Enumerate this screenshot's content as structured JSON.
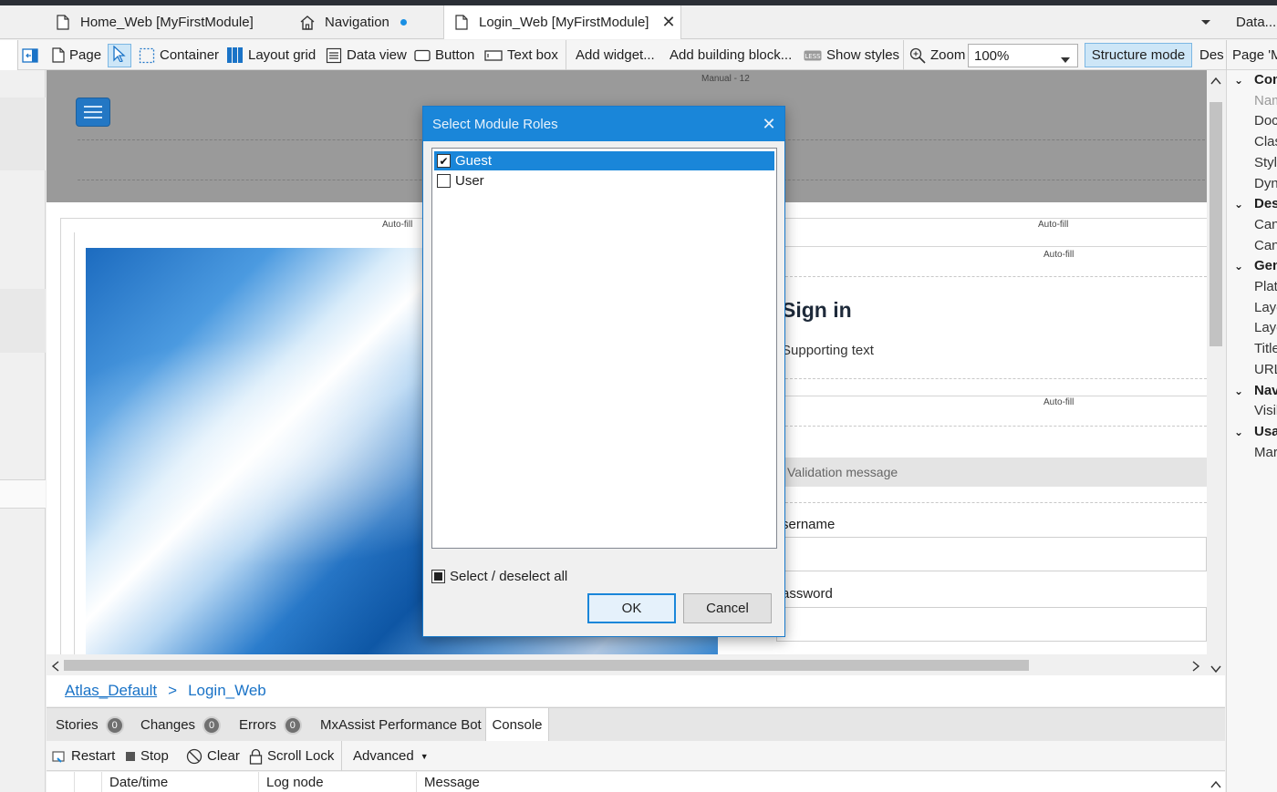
{
  "tabs": [
    {
      "label": "Home_Web [MyFirstModule]",
      "icon": "page-icon"
    },
    {
      "label": "Navigation",
      "icon": "home-icon",
      "modified": true
    },
    {
      "label": "Login_Web [MyFirstModule]",
      "icon": "page-icon",
      "active": true
    }
  ],
  "tabbar_right": "Data...",
  "toolbar": {
    "page": "Page",
    "container": "Container",
    "layout_grid": "Layout grid",
    "data_view": "Data view",
    "button": "Button",
    "text_box": "Text box",
    "add_widget": "Add widget...",
    "add_building_block": "Add building block...",
    "show_styles": "Show styles",
    "zoom": "Zoom",
    "zoom_value": "100%",
    "structure_mode": "Structure mode",
    "design": "Des",
    "page_props": "Page 'M"
  },
  "canvas": {
    "manual_label": "Manual - 12",
    "autofill": "Auto-fill",
    "sign_in": "Sign in",
    "supporting_text": "Supporting text",
    "validation_message": "Validation message",
    "username": "sername",
    "password": "assword"
  },
  "properties": [
    {
      "label": "Com",
      "category": true
    },
    {
      "label": "Nam",
      "category": false,
      "muted": true
    },
    {
      "label": "Doc",
      "category": false
    },
    {
      "label": "Clas",
      "category": false
    },
    {
      "label": "Styl",
      "category": false
    },
    {
      "label": "Dyn",
      "category": false
    },
    {
      "label": "Des",
      "category": true
    },
    {
      "label": "Can",
      "category": false
    },
    {
      "label": "Can",
      "category": false
    },
    {
      "label": "Gen",
      "category": true
    },
    {
      "label": "Plat",
      "category": false
    },
    {
      "label": "Layo",
      "category": false
    },
    {
      "label": "Layo",
      "category": false
    },
    {
      "label": "Title",
      "category": false
    },
    {
      "label": "URL",
      "category": false
    },
    {
      "label": "Nav",
      "category": true
    },
    {
      "label": "Visil",
      "category": false
    },
    {
      "label": "Usa",
      "category": true
    },
    {
      "label": "Mar",
      "category": false
    }
  ],
  "breadcrumb": {
    "parent": "Atlas_Default",
    "separator": ">",
    "current": "Login_Web"
  },
  "bottom_tabs": [
    {
      "label": "Stories",
      "badge": "0"
    },
    {
      "label": "Changes",
      "badge": "0"
    },
    {
      "label": "Errors",
      "badge": "0"
    },
    {
      "label": "MxAssist Performance Bot"
    },
    {
      "label": "Console",
      "active": true
    }
  ],
  "console_toolbar": {
    "restart": "Restart",
    "stop": "Stop",
    "clear": "Clear",
    "scroll_lock": "Scroll Lock",
    "advanced": "Advanced"
  },
  "log_columns": [
    "Date/time",
    "Log node",
    "Message"
  ],
  "dialog": {
    "title": "Select Module Roles",
    "roles": [
      {
        "label": "Guest",
        "checked": true,
        "selected": true
      },
      {
        "label": "User",
        "checked": false,
        "selected": false
      }
    ],
    "select_all": "Select / deselect all",
    "ok": "OK",
    "cancel": "Cancel"
  },
  "colors": {
    "accent": "#1a86d9",
    "link": "#1a73c7",
    "canvas_header": "#9a9a9a",
    "hamburger": "#2377c4"
  }
}
